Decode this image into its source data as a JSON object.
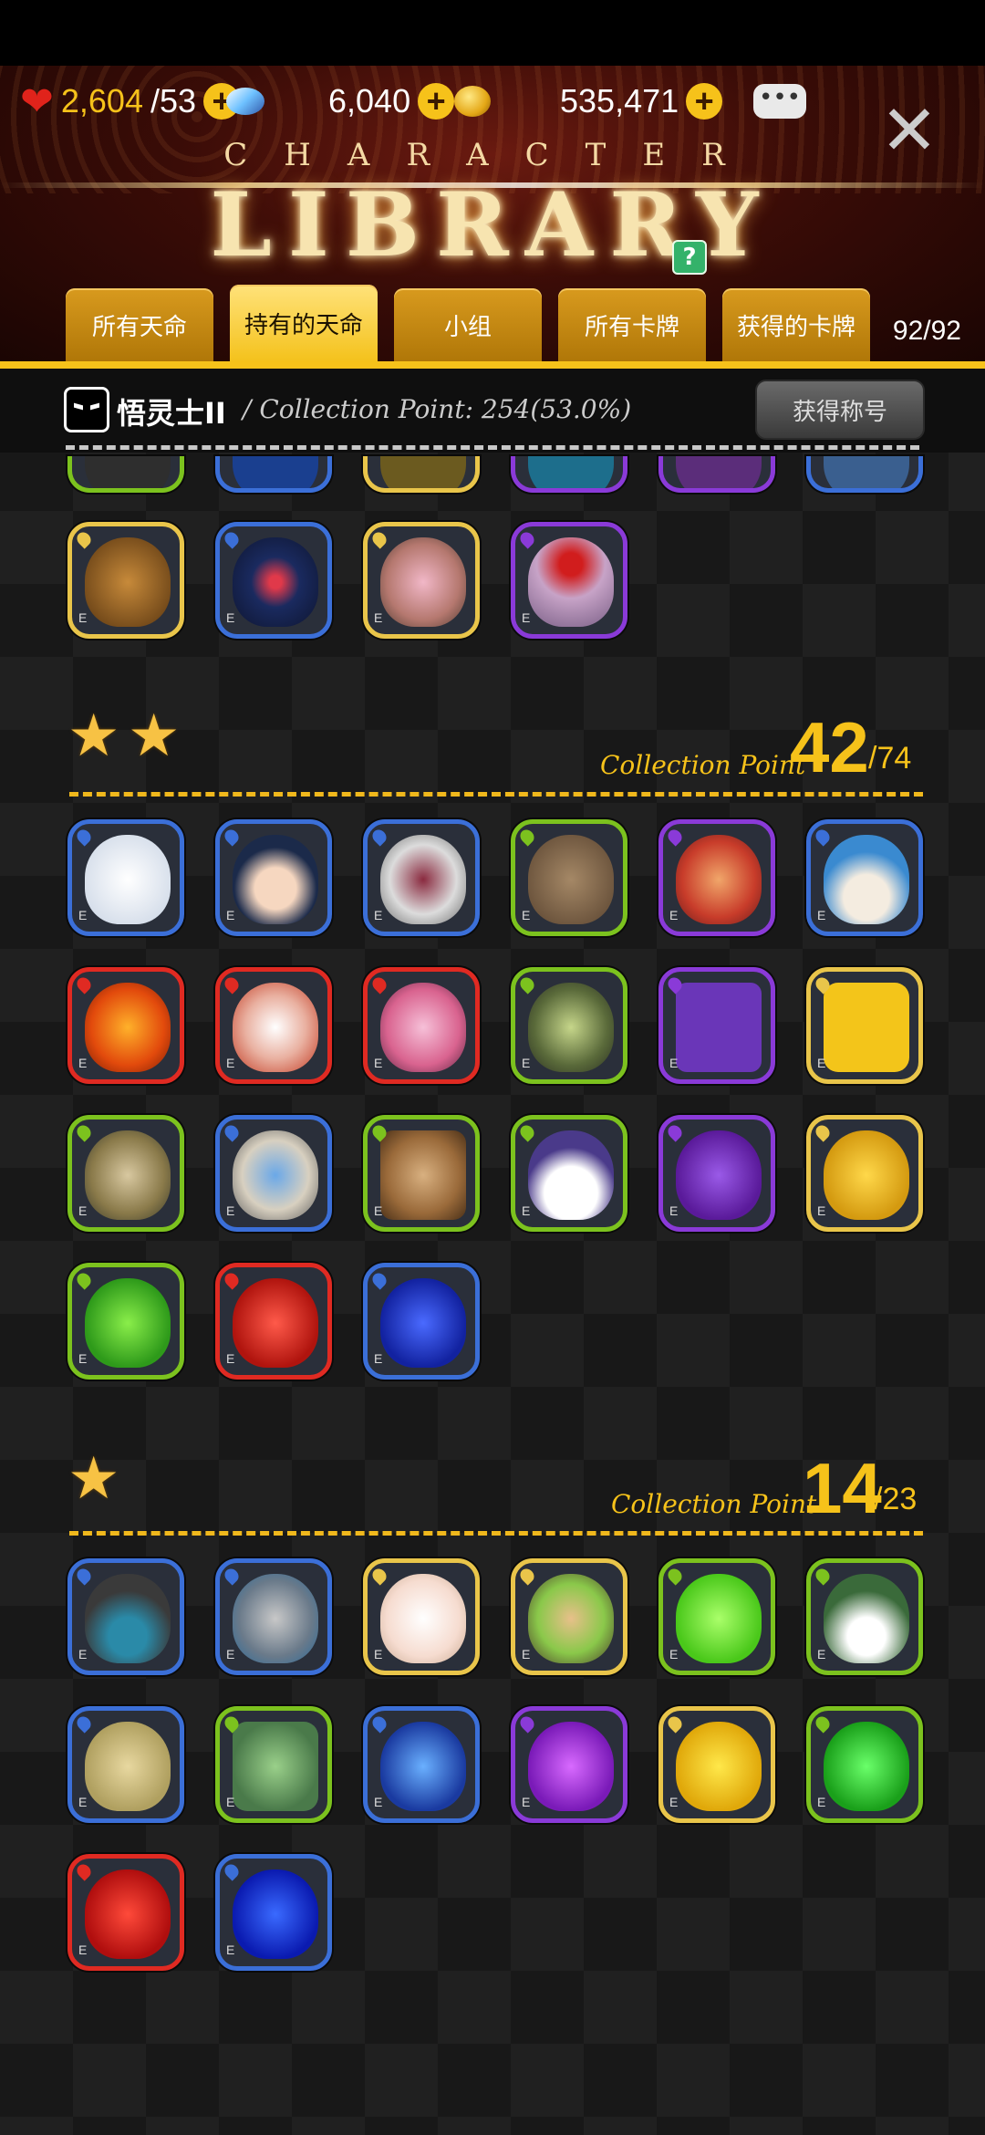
{
  "resources": {
    "hearts": "2,604",
    "hearts_max": "/53",
    "gems": "6,040",
    "gold": "535,471"
  },
  "header": {
    "title_small": "CHARACTER",
    "title_big": "LIBRARY",
    "help_icon": "?"
  },
  "tabs": [
    {
      "label": "所有天命"
    },
    {
      "label": "持有的天命"
    },
    {
      "label": "小组"
    },
    {
      "label": "所有卡牌"
    },
    {
      "label": "获得的卡牌"
    }
  ],
  "tab_count": "92/92",
  "collection": {
    "title": "悟灵士II",
    "subtitle": "/ Collection Point: 254(53.0%)",
    "button": "获得称号"
  },
  "sections": [
    {
      "label": "Collection Point",
      "points": "42",
      "total": "/74"
    },
    {
      "label": "Collection Point",
      "points": "14",
      "total": "/23"
    }
  ],
  "icons": {
    "close": "close-icon",
    "chat": "chat-icon",
    "star": "star-icon"
  },
  "colors": {
    "gold": "#f6c21a",
    "water": "#3b6fd8",
    "fire": "#e02a22",
    "earth": "#7cc21e",
    "dark": "#8a3ad8",
    "light": "#e9c54a"
  }
}
